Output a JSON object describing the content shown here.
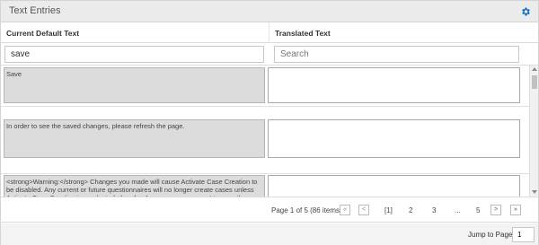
{
  "panel": {
    "title": "Text Entries",
    "settings_icon": "gear-icon",
    "accent": "#1a6fc0"
  },
  "columns": {
    "default_text": "Current Default Text",
    "translated_text": "Translated Text"
  },
  "filters": {
    "default_value": "save",
    "translated_placeholder": "Search"
  },
  "rows": [
    {
      "default_text": "Save",
      "translated_text": ""
    },
    {
      "default_text": "In order to see the saved changes, please refresh the page.",
      "translated_text": ""
    },
    {
      "default_text": "<strong>Warning:</strong> Changes you made will cause Activate Case Creation to be disabled. Any current or future questionnaires will no longer create cases unless Activate Case Creation is reselected.<hr><hr>Are you sure you want to save these changes?",
      "translated_text": ""
    }
  ],
  "pager": {
    "info": "Page 1 of 5 (86 items)",
    "first_icon": "double-chevron-left-icon",
    "prev_icon": "chevron-left-icon",
    "next_icon": "chevron-right-icon",
    "last_icon": "double-chevron-right-icon",
    "pages": [
      "[1]",
      "2",
      "3",
      "...",
      "5"
    ],
    "first": "«",
    "prev": "<",
    "next": ">",
    "last": "»"
  },
  "jump": {
    "label": "Jump to Page",
    "value": "1"
  }
}
